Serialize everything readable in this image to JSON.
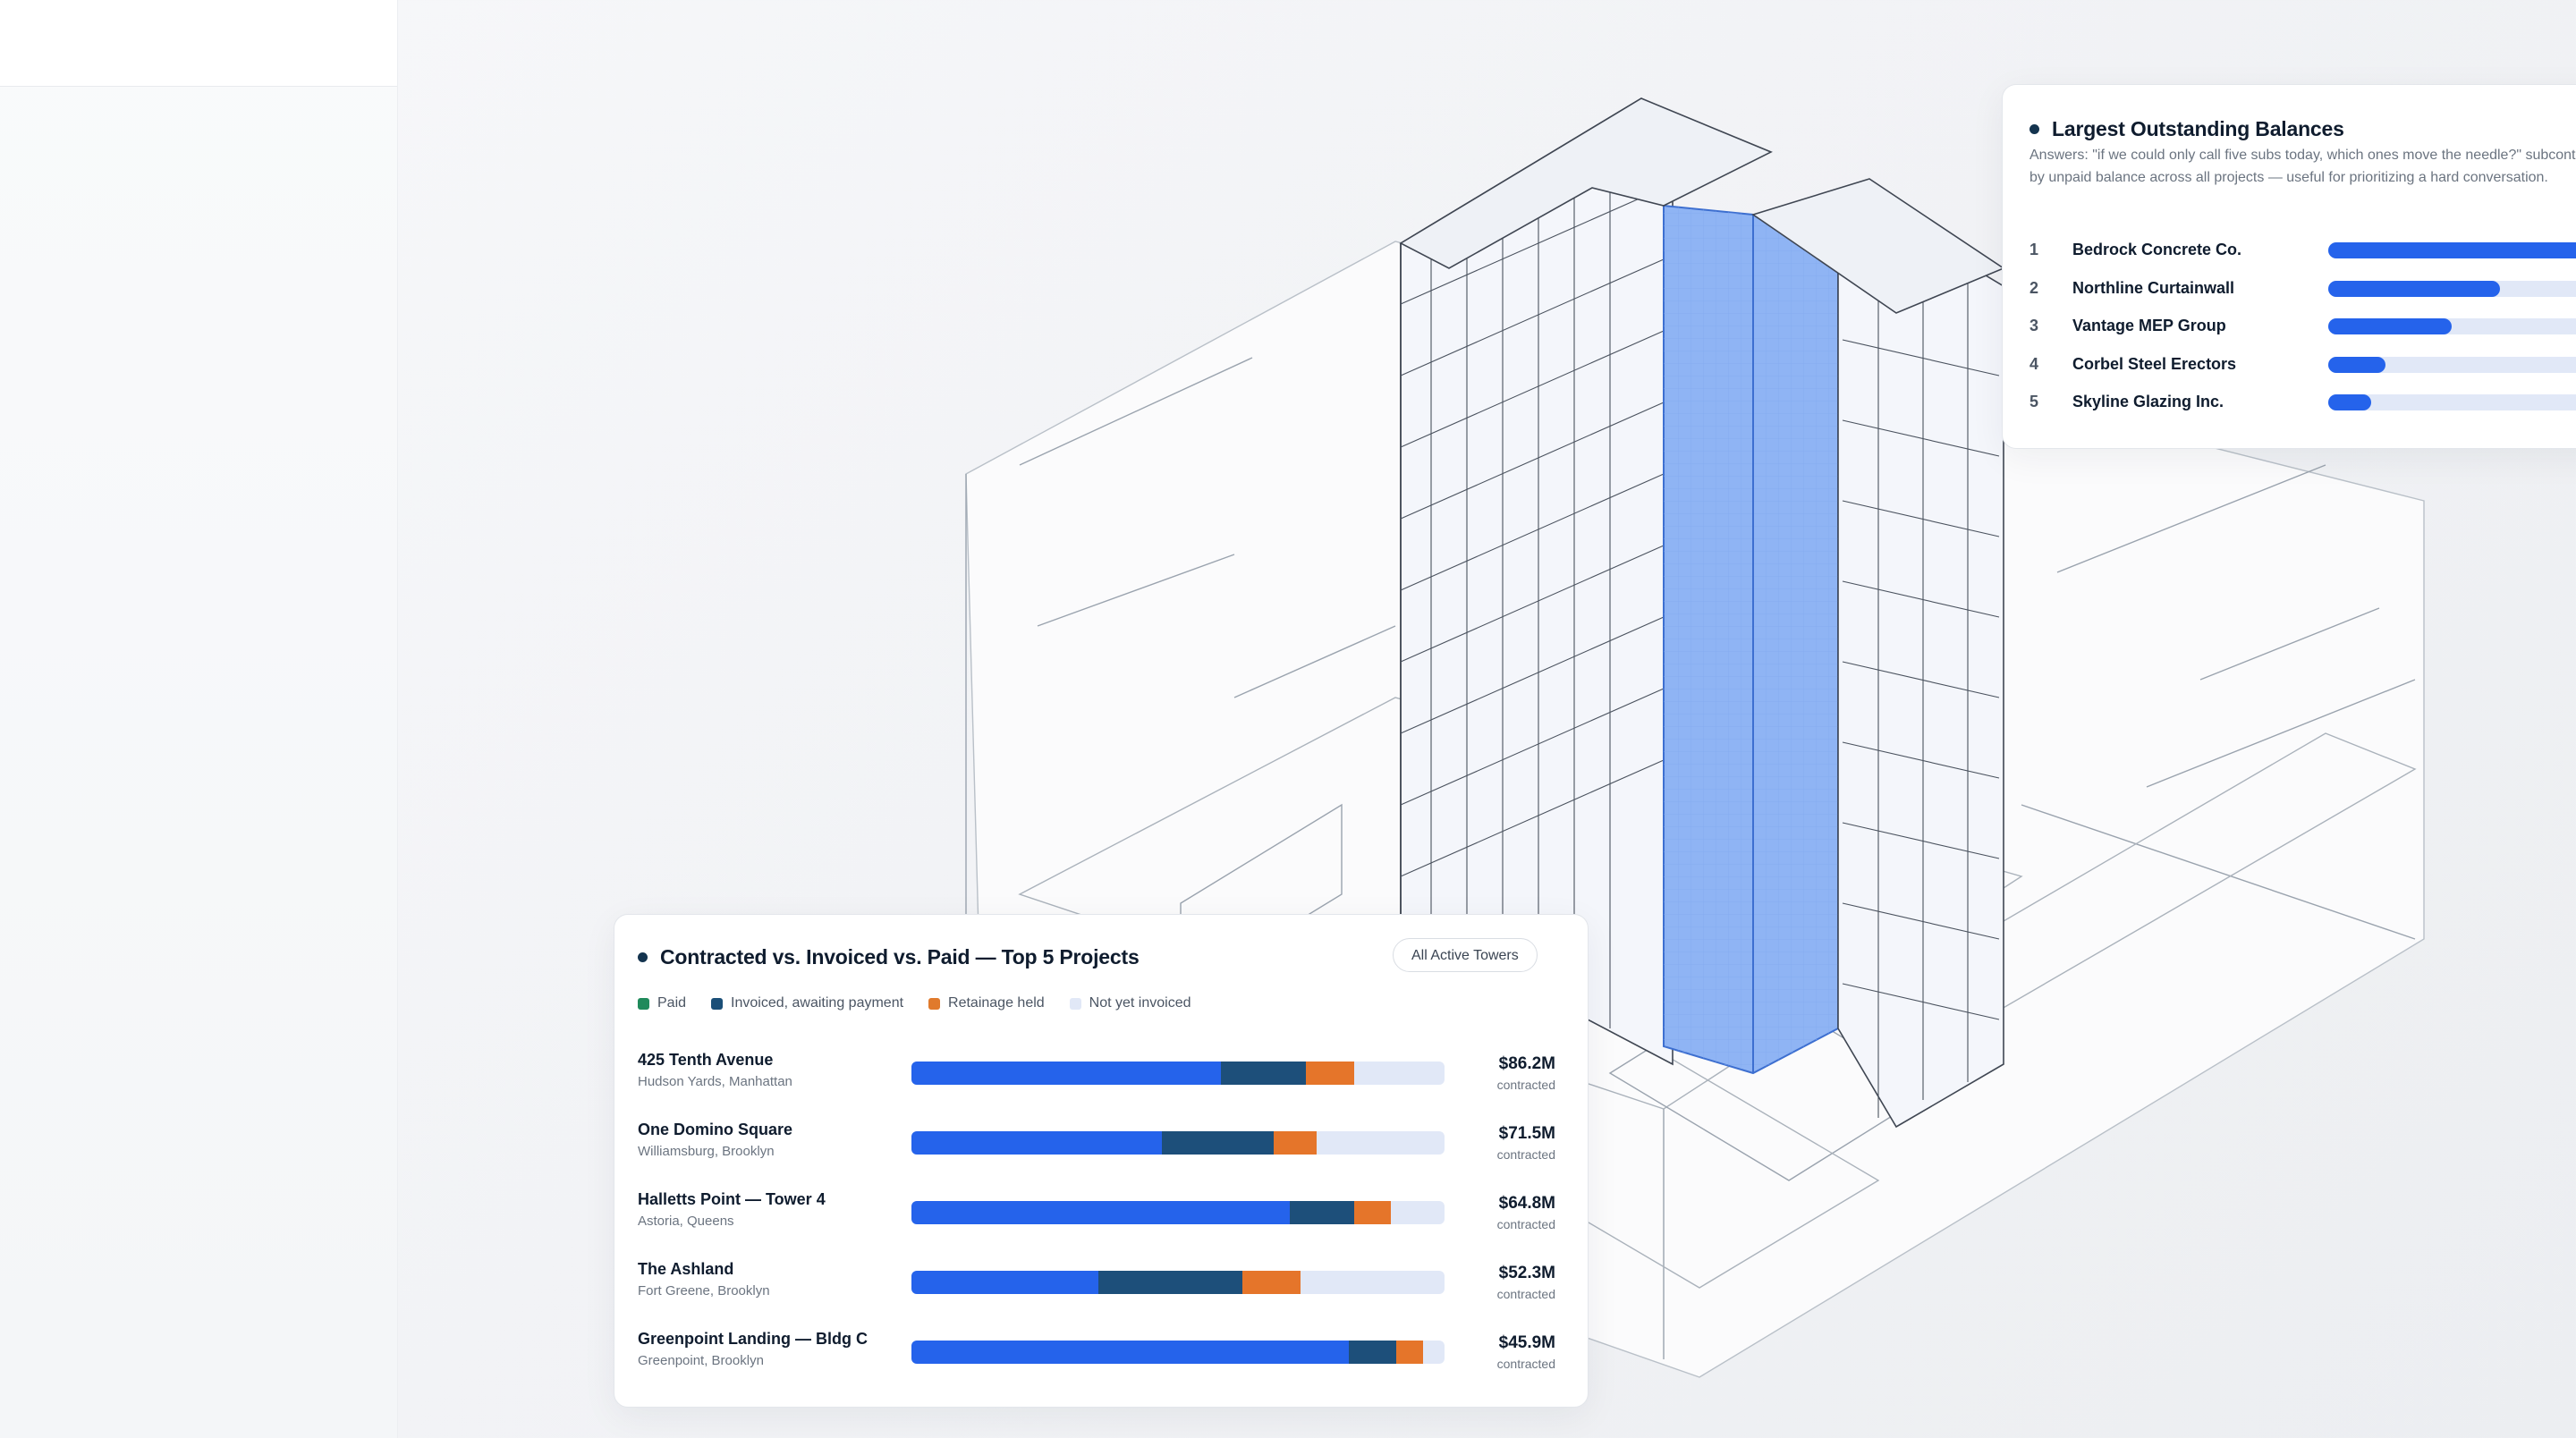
{
  "balances": {
    "title": "Largest Outstanding Balances",
    "description": "Answers: \"if we could only call five subs today, which ones move the needle?\" subcontractors by unpaid balance across all projects — useful for prioritizing a hard conversation.",
    "items": [
      {
        "rank": "1",
        "name": "Bedrock Concrete Co.",
        "share": 1.0
      },
      {
        "rank": "2",
        "name": "Northline Curtainwall",
        "share": 0.6
      },
      {
        "rank": "3",
        "name": "Vantage MEP Group",
        "share": 0.43
      },
      {
        "rank": "4",
        "name": "Corbel Steel Erectors",
        "share": 0.2
      },
      {
        "rank": "5",
        "name": "Skyline Glazing Inc.",
        "share": 0.15
      }
    ]
  },
  "projects_card": {
    "title": "Contracted vs. Invoiced vs. Paid — Top 5 Projects",
    "filter_label": "All Active Towers",
    "legend": [
      {
        "label": "Paid",
        "color": "#1f8a5b"
      },
      {
        "label": "Invoiced, awaiting payment",
        "color": "#1b4f78"
      },
      {
        "label": "Retainage held",
        "color": "#e07a2c"
      },
      {
        "label": "Not yet invoiced",
        "color": "#e1e8f7"
      }
    ],
    "bar_colors": {
      "paid": "#2563eb",
      "invoiced": "#1d4f7a",
      "retainage": "#e5752a",
      "not_invoiced": "#e1e8f7"
    },
    "projects": [
      {
        "name": "425 Tenth Avenue",
        "location": "Hudson Yards, Manhattan",
        "value": "$86.2M",
        "unit": "contracted",
        "paid": 0.58,
        "invoiced": 0.16,
        "retainage": 0.09
      },
      {
        "name": "One Domino Square",
        "location": "Williamsburg, Brooklyn",
        "value": "$71.5M",
        "unit": "contracted",
        "paid": 0.47,
        "invoiced": 0.21,
        "retainage": 0.08
      },
      {
        "name": "Halletts Point — Tower 4",
        "location": "Astoria, Queens",
        "value": "$64.8M",
        "unit": "contracted",
        "paid": 0.71,
        "invoiced": 0.12,
        "retainage": 0.07
      },
      {
        "name": "The Ashland",
        "location": "Fort Greene, Brooklyn",
        "value": "$52.3M",
        "unit": "contracted",
        "paid": 0.35,
        "invoiced": 0.27,
        "retainage": 0.11
      },
      {
        "name": "Greenpoint Landing — Bldg C",
        "location": "Greenpoint, Brooklyn",
        "value": "$45.9M",
        "unit": "contracted",
        "paid": 0.82,
        "invoiced": 0.09,
        "retainage": 0.05
      }
    ]
  }
}
